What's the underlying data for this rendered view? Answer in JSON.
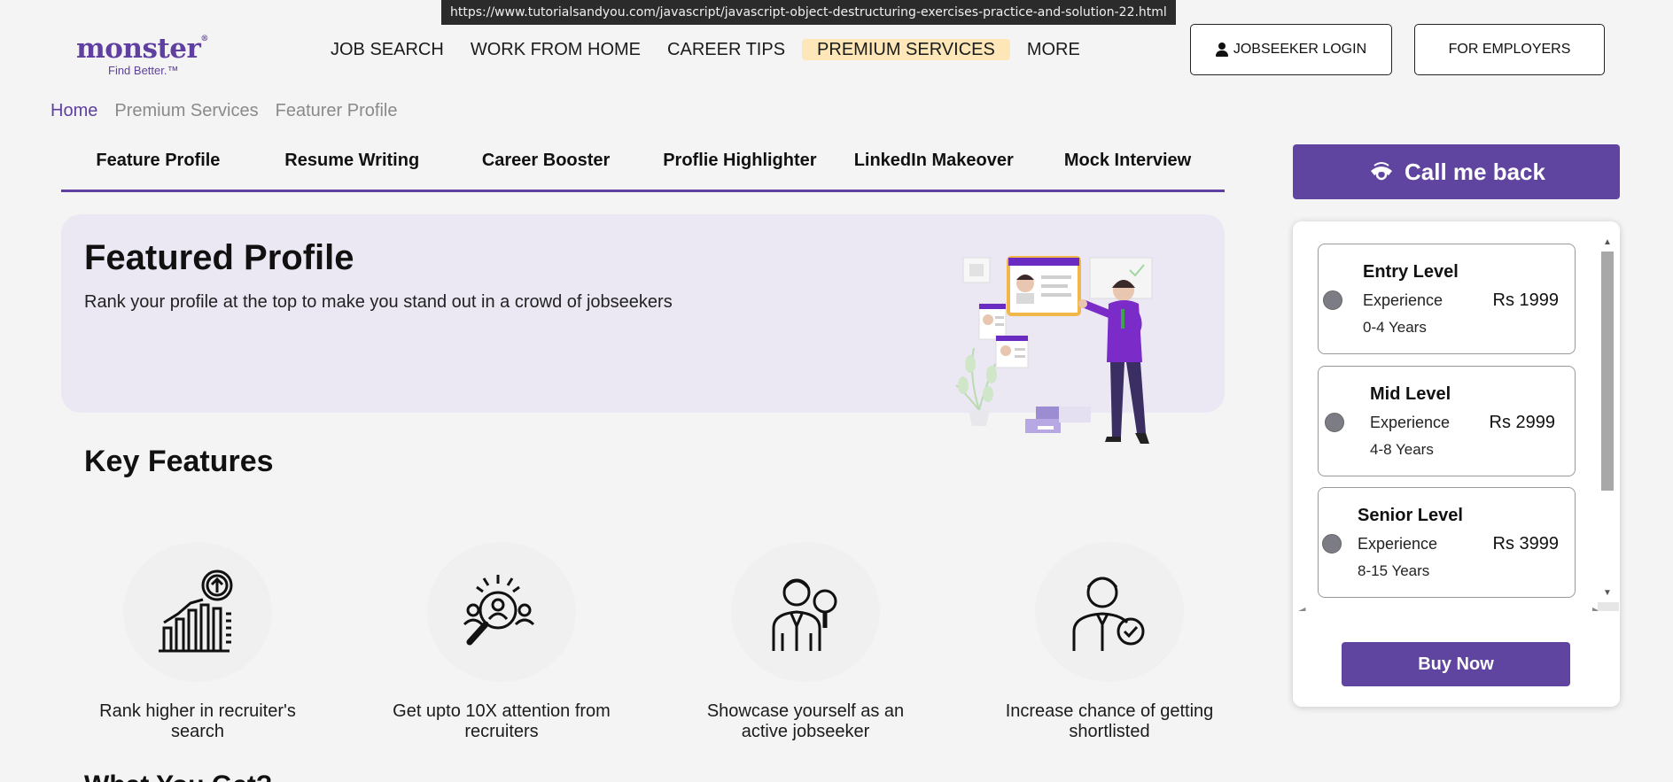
{
  "status_url": "https://www.tutorialsandyou.com/javascript/javascript-object-destructuring-exercises-practice-and-solution-22.html",
  "logo": {
    "word": "monster",
    "reg": "®",
    "tagline": "Find Better.™"
  },
  "nav": {
    "items": [
      "JOB SEARCH",
      "WORK FROM HOME",
      "CAREER TIPS",
      "PREMIUM SERVICES",
      "MORE"
    ],
    "jobseeker_login": "JOBSEEKER LOGIN",
    "for_employers": "FOR EMPLOYERS"
  },
  "breadcrumb": [
    "Home",
    "Premium Services",
    "Featurer Profile"
  ],
  "tabs": [
    "Feature Profile",
    "Resume Writing",
    "Career Booster",
    "Proflie Highlighter",
    "LinkedIn Makeover",
    "Mock Interview"
  ],
  "hero": {
    "title": "Featured Profile",
    "subtitle": "Rank your profile at the top to make you stand out in a crowd of jobseekers"
  },
  "key_features": {
    "title": "Key Features",
    "items": [
      {
        "icon": "rank-chart-icon",
        "line1": "Rank higher in recruiter's",
        "line2": "search"
      },
      {
        "icon": "attention-search-icon",
        "line1": "Get upto 10X attention from",
        "line2": "recruiters"
      },
      {
        "icon": "showcase-person-icon",
        "line1": "Showcase yourself as an",
        "line2": "active jobseeker"
      },
      {
        "icon": "shortlisted-person-icon",
        "line1": "Increase chance of getting",
        "line2": "shortlisted"
      }
    ],
    "next_heading_partial": "What You Get?"
  },
  "side": {
    "callback_label": "Call me back",
    "plans": [
      {
        "name": "Entry Level",
        "exp_label": "Experience",
        "years": "0-4 Years",
        "price": "Rs 1999"
      },
      {
        "name": "Mid Level",
        "exp_label": "Experience",
        "years": "4-8 Years",
        "price": "Rs 2999"
      },
      {
        "name": "Senior Level",
        "exp_label": "Experience",
        "years": "8-15 Years",
        "price": "Rs 3999"
      }
    ],
    "buy_label": "Buy Now"
  },
  "colors": {
    "brand": "#5f44a0",
    "active_nav_bg": "#fde7b8",
    "hero_bg": "#ebe8f4"
  }
}
